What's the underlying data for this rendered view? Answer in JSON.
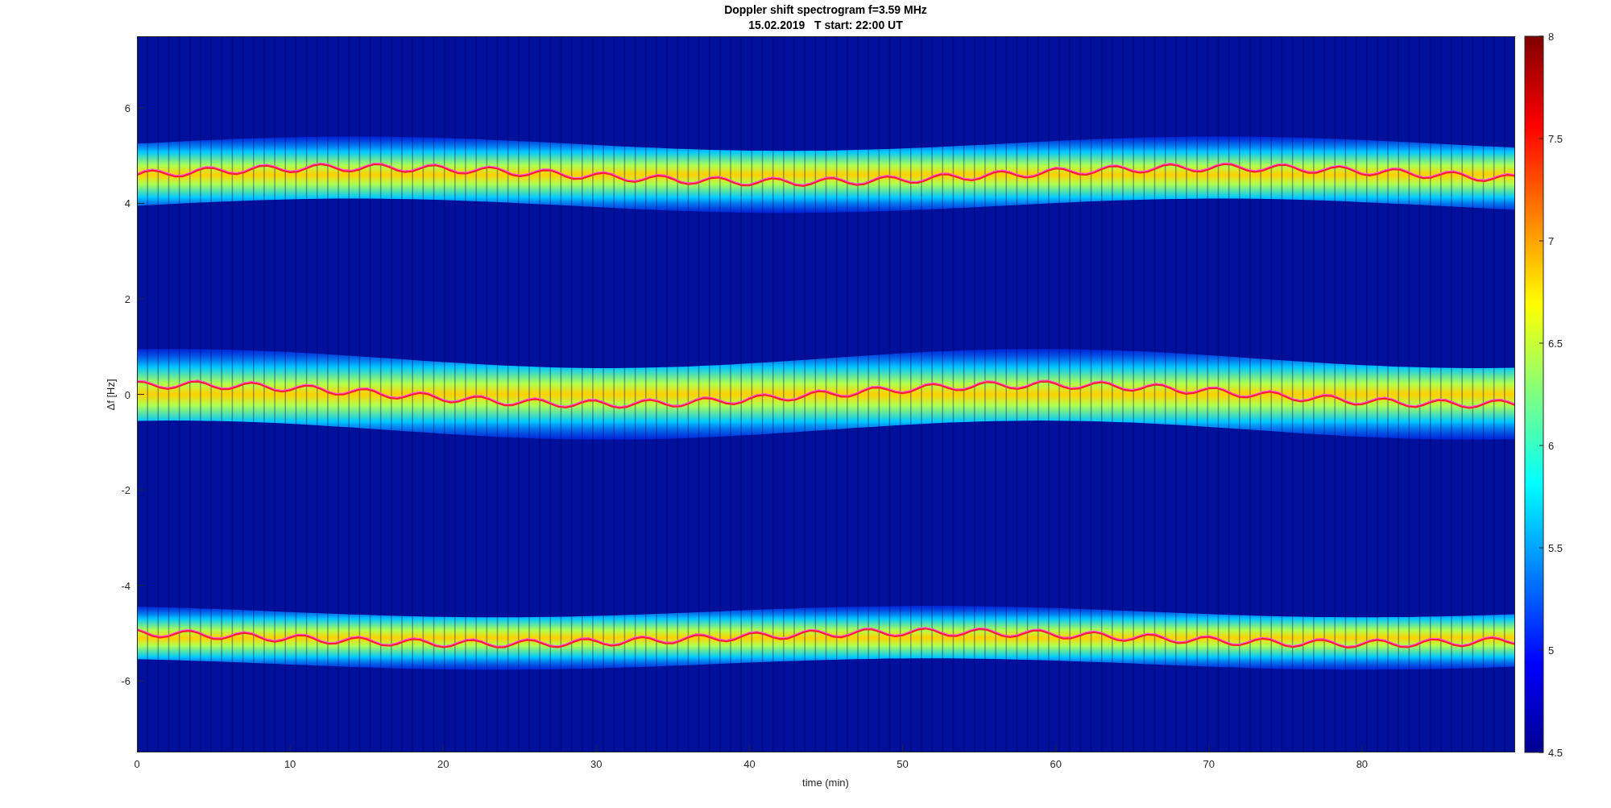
{
  "figure": {
    "title": [
      "Doppler shift spectrogram f=3.59 MHz",
      "15.02.2019   T start: 22:00 UT"
    ],
    "xlabel": "time (min)",
    "ylabel": "Δf [Hz]",
    "xticks": [
      "0",
      "10",
      "20",
      "30",
      "40",
      "50",
      "60",
      "70",
      "80"
    ],
    "yticks": [
      "6",
      "4",
      "2",
      "0",
      "-2",
      "-4",
      "-6"
    ],
    "colorbar_ticks": [
      "8",
      "7.5",
      "7",
      "6.5",
      "6",
      "5.5",
      "5",
      "4.5"
    ]
  }
}
